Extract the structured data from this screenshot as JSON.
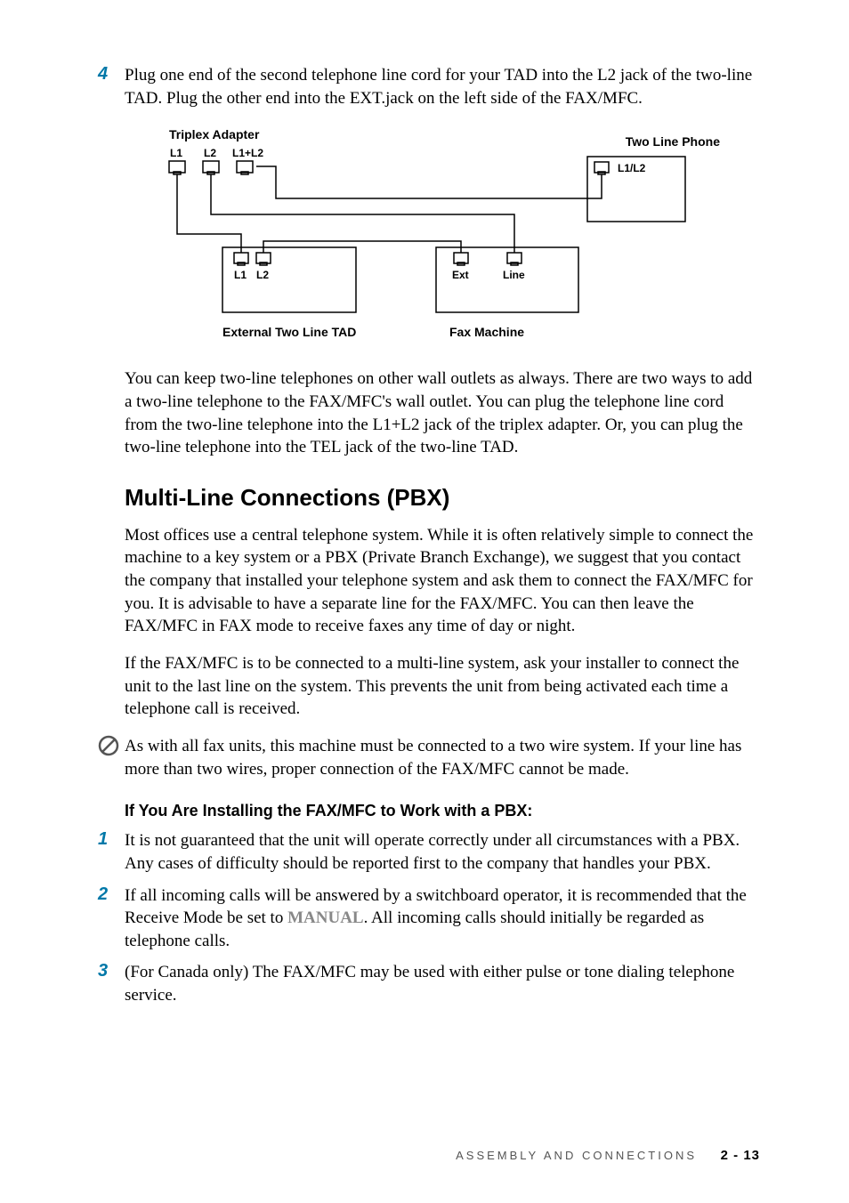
{
  "step4": {
    "number": "4",
    "text": "Plug one end of the second telephone line cord for your TAD into the L2 jack of the two-line TAD. Plug the other end into the EXT.jack on the left side of the FAX/MFC."
  },
  "diagram": {
    "triplex_label": "Triplex Adapter",
    "two_line_phone_label": "Two Line Phone",
    "external_tad_label": "External Two Line TAD",
    "fax_machine_label": "Fax Machine",
    "l1": "L1",
    "l2": "L2",
    "l1l2": "L1+L2",
    "l1_l2_slash": "L1/L2",
    "ext": "Ext",
    "line": "Line"
  },
  "paragraph_after_diagram": "You can keep two-line telephones on other wall outlets as always. There are two ways to add a two-line telephone to the FAX/MFC's wall outlet. You can plug the telephone line cord from the two-line telephone into the L1+L2 jack of the triplex adapter.  Or, you can plug the two-line telephone into the TEL jack of the two-line TAD.",
  "section_heading": "Multi-Line Connections (PBX)",
  "section_p1": "Most offices use a central telephone system. While it is often relatively simple to connect the machine to a key system or a PBX (Private Branch Exchange), we suggest that you contact the company that installed your telephone system and ask them to connect the FAX/MFC for you. It is advisable to have a separate line for the FAX/MFC. You can then leave the FAX/MFC in FAX mode to receive faxes any time of day or night.",
  "section_p2": "If the FAX/MFC is to be connected to a multi-line system, ask your installer to connect the unit to the last line on the system. This prevents the unit from being activated each time a telephone call is received.",
  "note_text": "As with all fax units, this machine must be connected to a two wire system. If your line has more than two wires, proper connection of the FAX/MFC cannot be made.",
  "sub_heading": "If You Are Installing the FAX/MFC to Work with a PBX:",
  "pbx_steps": {
    "s1": {
      "num": "1",
      "text": "It is not guaranteed that the unit will operate correctly under all circumstances with a PBX. Any cases of difficulty should be reported first to the company that handles your PBX."
    },
    "s2": {
      "num": "2",
      "before": "If all incoming calls will be answered by a switchboard operator, it is recommended that the Receive Mode be set to ",
      "manual": "MANUAL",
      "after": ". All incoming calls should initially be regarded as telephone calls."
    },
    "s3": {
      "num": "3",
      "text": "(For Canada only) The FAX/MFC may be used with either pulse or tone dialing telephone service."
    }
  },
  "footer": {
    "section_name": "ASSEMBLY AND CONNECTIONS",
    "page_number": "2 - 13"
  }
}
